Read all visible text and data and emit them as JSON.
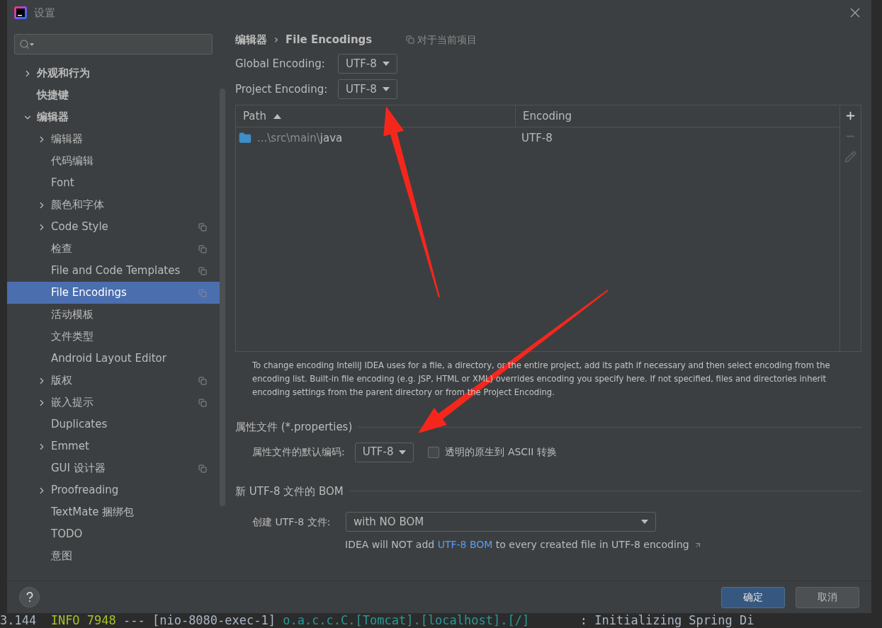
{
  "window": {
    "title": "设置"
  },
  "sidebar": {
    "items": [
      {
        "label": "外观和行为",
        "expanded": false,
        "selected": false,
        "project_scope": false
      },
      {
        "label": "快捷键",
        "selected": false,
        "project_scope": false
      },
      {
        "label": "编辑器",
        "expanded": true,
        "selected": false,
        "project_scope": false,
        "children": [
          {
            "label": "编辑器",
            "expanded": false,
            "selected": false,
            "project_scope": false
          },
          {
            "label": "代码编辑",
            "selected": false,
            "project_scope": false
          },
          {
            "label": "Font",
            "selected": false,
            "project_scope": false
          },
          {
            "label": "颜色和字体",
            "expanded": false,
            "selected": false,
            "project_scope": false
          },
          {
            "label": "Code Style",
            "expanded": false,
            "selected": false,
            "project_scope": true
          },
          {
            "label": "检查",
            "selected": false,
            "project_scope": true
          },
          {
            "label": "File and Code Templates",
            "selected": false,
            "project_scope": true
          },
          {
            "label": "File Encodings",
            "selected": true,
            "project_scope": true
          },
          {
            "label": "活动模板",
            "selected": false,
            "project_scope": false
          },
          {
            "label": "文件类型",
            "selected": false,
            "project_scope": false
          },
          {
            "label": "Android Layout Editor",
            "selected": false,
            "project_scope": false
          },
          {
            "label": "版权",
            "expanded": false,
            "selected": false,
            "project_scope": true
          },
          {
            "label": "嵌入提示",
            "expanded": false,
            "selected": false,
            "project_scope": true
          },
          {
            "label": "Duplicates",
            "selected": false,
            "project_scope": false
          },
          {
            "label": "Emmet",
            "expanded": false,
            "selected": false,
            "project_scope": false
          },
          {
            "label": "GUI 设计器",
            "selected": false,
            "project_scope": true
          },
          {
            "label": "Proofreading",
            "expanded": false,
            "selected": false,
            "project_scope": false
          },
          {
            "label": "TextMate 捆绑包",
            "selected": false,
            "project_scope": false
          },
          {
            "label": "TODO",
            "selected": false,
            "project_scope": false
          },
          {
            "label": "意图",
            "selected": false,
            "project_scope": false
          }
        ]
      }
    ]
  },
  "breadcrumb": {
    "parent": "编辑器",
    "separator": "›",
    "current": "File Encodings",
    "scope": "对于当前项目"
  },
  "fields": [
    {
      "label": "Global Encoding:",
      "value": "UTF-8"
    },
    {
      "label": "Project Encoding:",
      "value": "UTF-8"
    }
  ],
  "table": {
    "columns": [
      {
        "label": "Path",
        "sorted": true
      },
      {
        "label": "Encoding",
        "sorted": false
      }
    ],
    "rows": [
      {
        "path_dim": "...\\src\\main\\",
        "path": "java",
        "encoding": "UTF-8"
      }
    ],
    "tools": [
      {
        "kind": "add",
        "disabled": false
      },
      {
        "kind": "remove",
        "disabled": true
      },
      {
        "kind": "edit",
        "disabled": true
      }
    ]
  },
  "description": "To change encoding IntelliJ IDEA uses for a file, a directory, or the entire project, add its path if necessary and then select encoding from the encoding list. Built-in file encoding (e.g. JSP, HTML or XML) overrides encoding you specify here. If not specified, files and directories inherit encoding settings from the parent directory or from the Project Encoding.",
  "properties": {
    "title": "属性文件 (*.properties)",
    "label": "属性文件的默认编码:",
    "value": "UTF-8",
    "checkbox": {
      "label": "透明的原生到 ASCII 转换",
      "checked": false
    }
  },
  "bom": {
    "title": "新 UTF-8 文件的 BOM",
    "label": "创建 UTF-8 文件:",
    "value": "with NO BOM",
    "note_before": "IDEA will NOT add ",
    "note_link": "UTF-8 BOM",
    "note_after": " to every created file in UTF-8 encoding"
  },
  "buttons": [
    {
      "label": "确定",
      "primary": true
    },
    {
      "label": "取消",
      "primary": false
    }
  ],
  "log_line": [
    {
      "text": "3.144  ",
      "color": "#a9b7c6"
    },
    {
      "text": "INFO 7948",
      "color": "#a8c023"
    },
    {
      "text": " --- [nio-8080-exec-1] ",
      "color": "#a9b7c6"
    },
    {
      "text": "o.a.c.c.C.[Tomcat].[localhost].[/]",
      "color": "#299999"
    },
    {
      "text": "       : Initializing Spring Di",
      "color": "#a9b7c6"
    }
  ]
}
